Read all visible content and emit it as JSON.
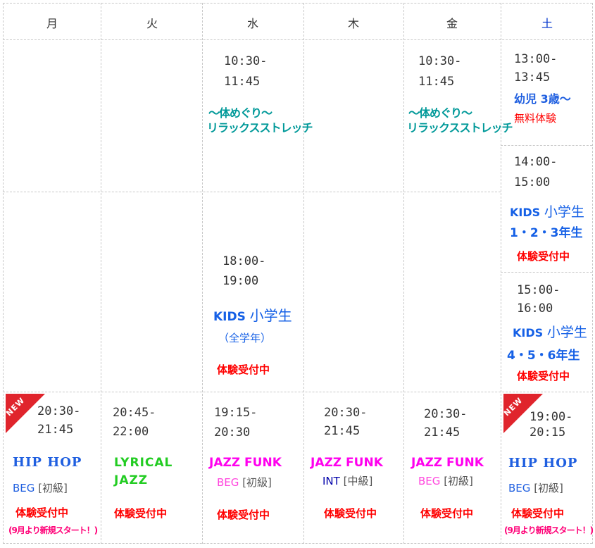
{
  "days": [
    "月",
    "火",
    "水",
    "木",
    "金",
    "土"
  ],
  "colors": {
    "saturday": "#0033cc",
    "hiphop": "#1f5fe0",
    "teal": "#009999",
    "trial": "#ff0000",
    "lyrical": "#22cc22",
    "jazzfunk": "#ff00ee",
    "int": "#0000aa",
    "kids": "#1560e6",
    "new_ribbon": "#e0242c"
  },
  "morning": {
    "wed": {
      "time1": "10:30-",
      "time2": "11:45",
      "title1": "～体めぐり～",
      "title2": "リラックスストレッチ"
    },
    "fri": {
      "time1": "10:30-",
      "time2": "11:45",
      "title1": "～体めぐり～",
      "title2": "リラックスストレッチ"
    },
    "sat": {
      "time1": "13:00-",
      "time2": "13:45",
      "title": "幼児 3歳～",
      "trial": "無料体験"
    }
  },
  "afternoon": {
    "wed": {
      "time1": "18:00-",
      "time2": "19:00",
      "kids": "KIDS",
      "title": "小学生",
      "sub": "（全学年）",
      "trial": "体験受付中"
    },
    "sat1": {
      "time1": "14:00-",
      "time2": "15:00",
      "kids": "KIDS",
      "title": "小学生",
      "grades": "1・2・3年生",
      "trial": "体験受付中"
    },
    "sat2": {
      "time1": "15:00-",
      "time2": "16:00",
      "kids": "KIDS",
      "title": "小学生",
      "grades": "4・5・6年生",
      "trial": "体験受付中"
    }
  },
  "evening": {
    "mon": {
      "badge": "NEW",
      "time1": "20:30-",
      "time2": "21:45",
      "class": "HIP HOP",
      "level": "BEG",
      "level_jp": "[初級]",
      "trial": "体験受付中",
      "note": "(9月より新規スタート！)"
    },
    "tue": {
      "time1": "20:45-",
      "time2": "22:00",
      "class1": "LYRICAL",
      "class2": "JAZZ",
      "trial": "体験受付中"
    },
    "wed": {
      "time1": "19:15-",
      "time2": "20:30",
      "class": "JAZZ FUNK",
      "level": "BEG",
      "level_jp": "[初級]",
      "trial": "体験受付中"
    },
    "thu": {
      "time1": "20:30-",
      "time2": "21:45",
      "class": "JAZZ FUNK",
      "level": "INT",
      "level_jp": "[中級]",
      "trial": "体験受付中"
    },
    "fri": {
      "time1": "20:30-",
      "time2": "21:45",
      "class": "JAZZ FUNK",
      "level": "BEG",
      "level_jp": "[初級]",
      "trial": "体験受付中"
    },
    "sat": {
      "badge": "NEW",
      "time1": "19:00-",
      "time2": "20:15",
      "class": "HIP HOP",
      "level": "BEG",
      "level_jp": "[初級]",
      "trial": "体験受付中",
      "note": "(9月より新規スタート！)"
    }
  }
}
